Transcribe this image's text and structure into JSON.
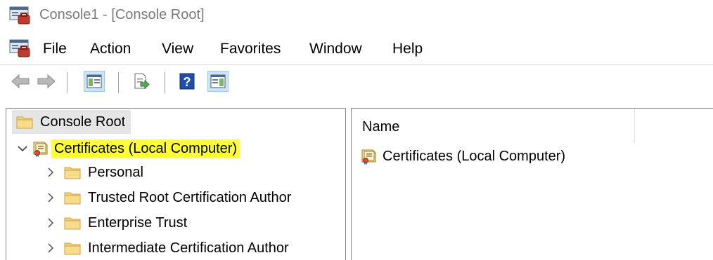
{
  "window": {
    "title": "Console1 - [Console Root]"
  },
  "menu": {
    "items": [
      "File",
      "Action",
      "View",
      "Favorites",
      "Window",
      "Help"
    ]
  },
  "toolbar": {
    "buttons": [
      {
        "icon": "back-arrow-icon"
      },
      {
        "icon": "forward-arrow-icon"
      },
      {
        "icon": "show-hide-console-tree-icon"
      },
      {
        "icon": "export-list-icon"
      },
      {
        "icon": "help-icon"
      },
      {
        "icon": "show-hide-action-pane-icon"
      }
    ]
  },
  "tree": {
    "root": "Console Root",
    "selected": "Certificates (Local Computer)",
    "children": [
      "Personal",
      "Trusted Root Certification Author",
      "Enterprise Trust",
      "Intermediate Certification Author"
    ]
  },
  "list": {
    "column_name": "Name",
    "items": [
      "Certificates (Local Computer)"
    ]
  },
  "colors": {
    "highlight": "#ffff33",
    "active_button": "#cce4f7",
    "folder": "#f3d27a"
  }
}
